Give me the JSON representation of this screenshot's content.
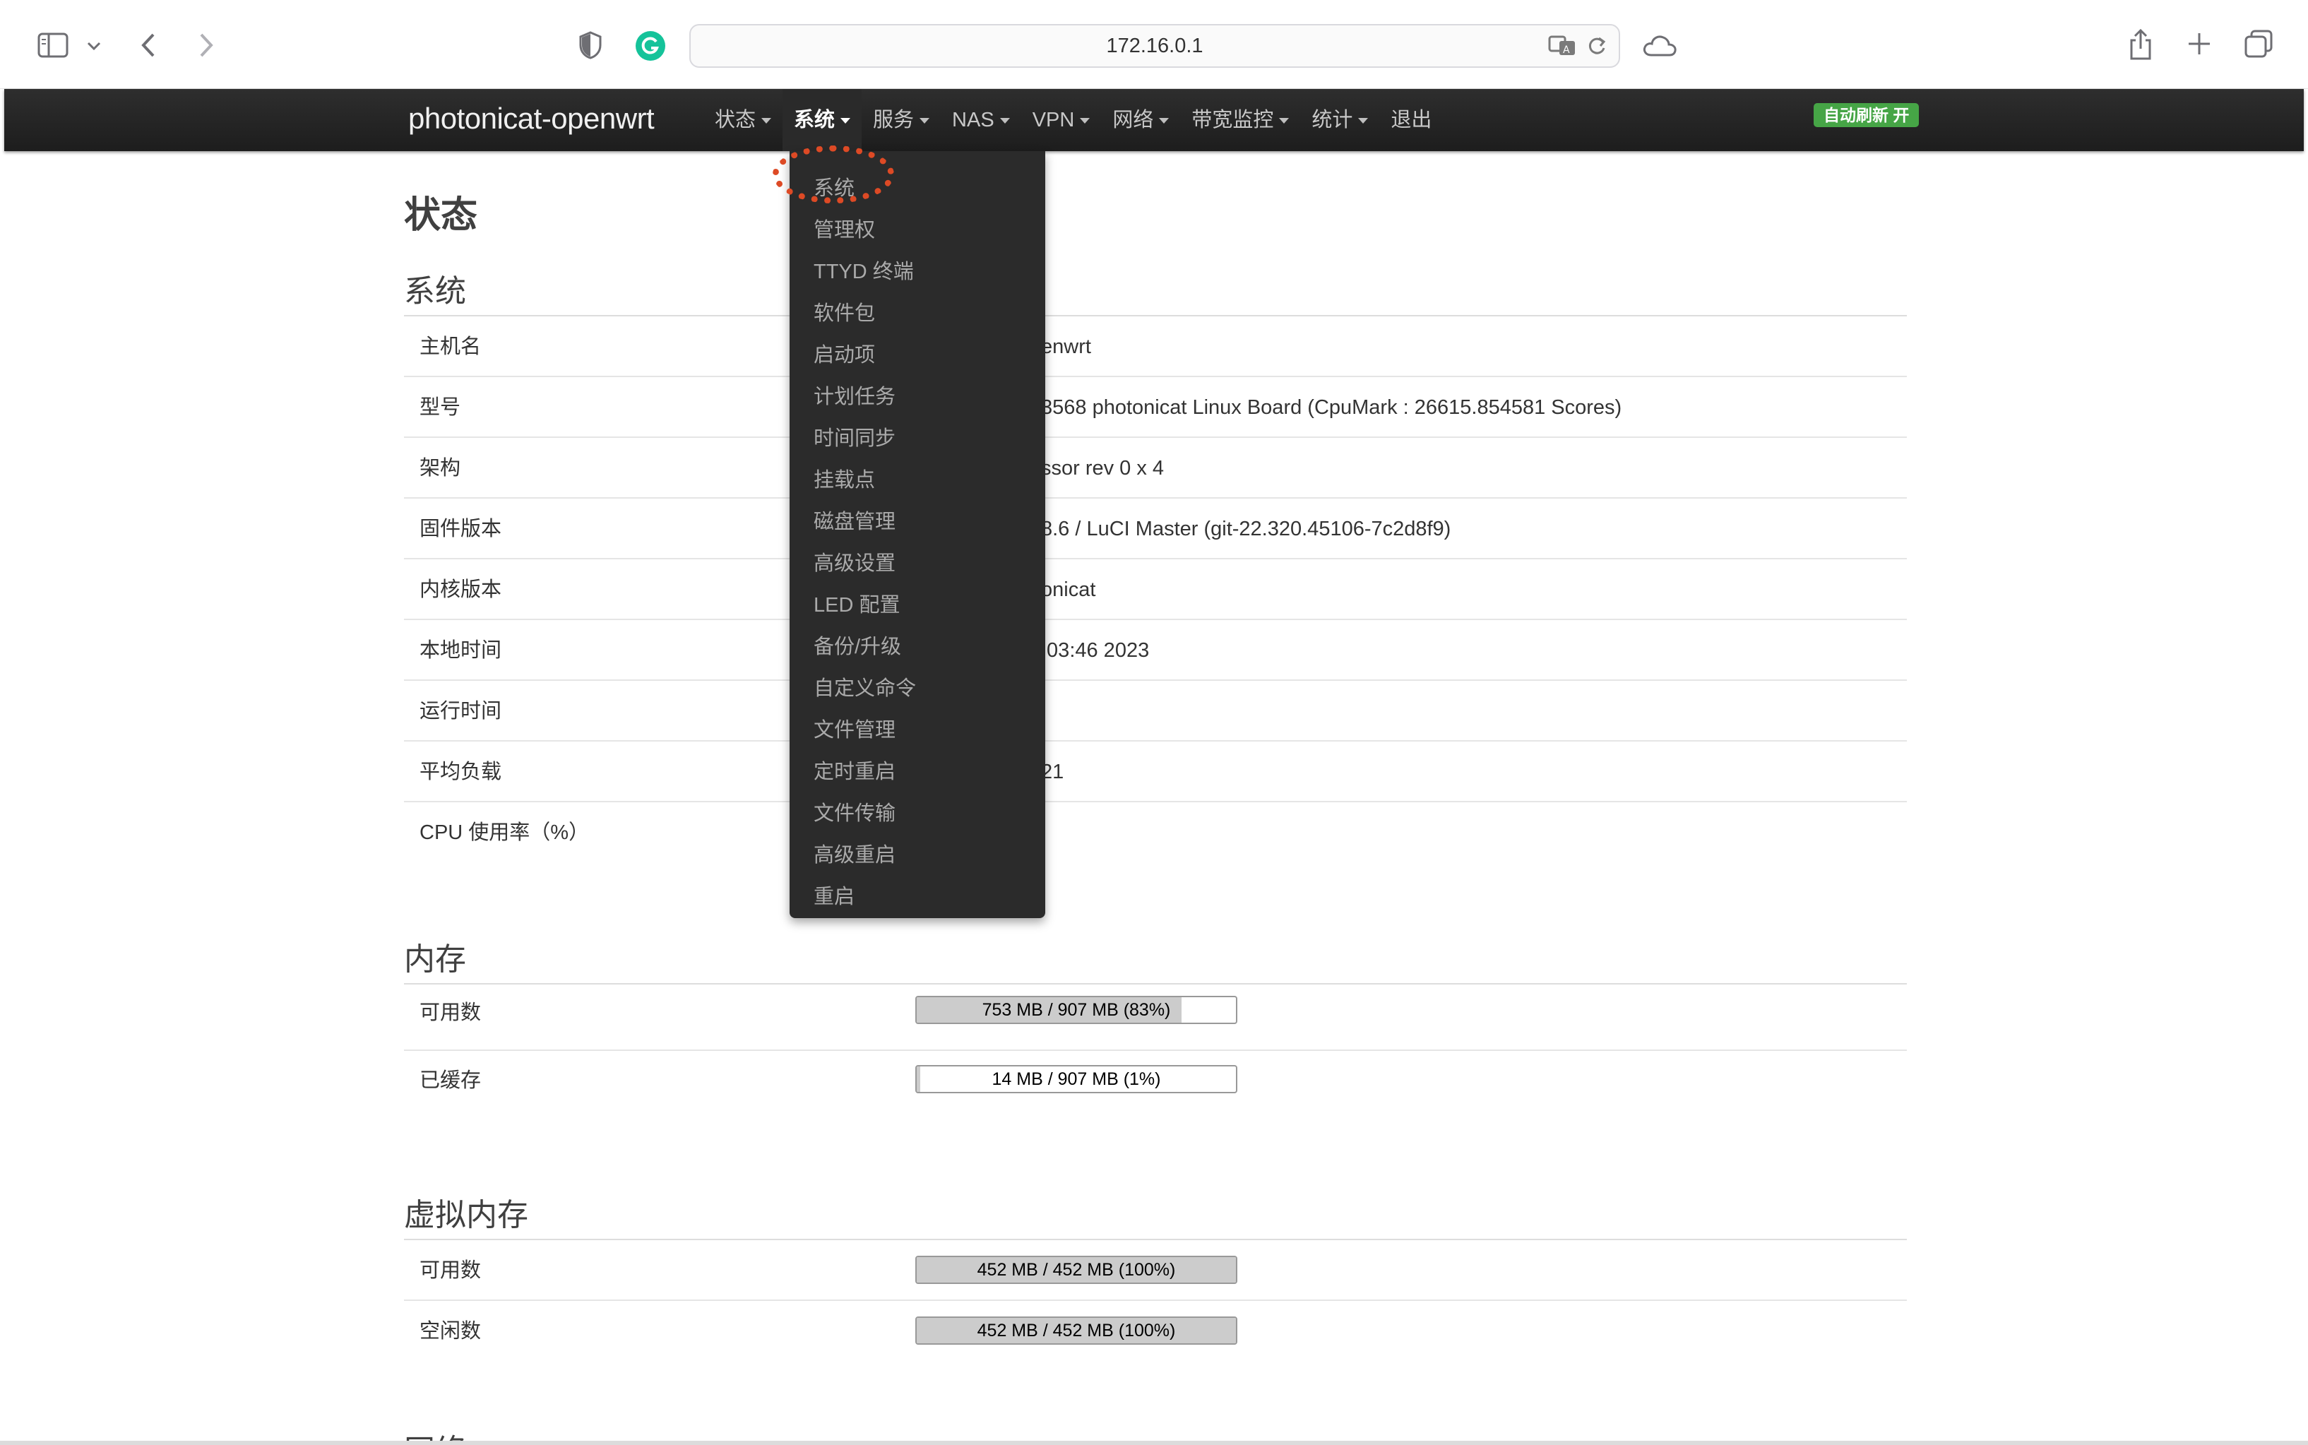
{
  "browser": {
    "url": "172.16.0.1"
  },
  "navbar": {
    "brand": "photonicat-openwrt",
    "items": [
      {
        "label": "状态"
      },
      {
        "label": "系统"
      },
      {
        "label": "服务"
      },
      {
        "label": "NAS"
      },
      {
        "label": "VPN"
      },
      {
        "label": "网络"
      },
      {
        "label": "带宽监控"
      },
      {
        "label": "统计"
      },
      {
        "label": "退出"
      }
    ],
    "active_index": 1,
    "auto_refresh": "自动刷新 开",
    "auto_refresh_color": "#46a546"
  },
  "dropdown": {
    "items": [
      "系统",
      "管理权",
      "TTYD 终端",
      "软件包",
      "启动项",
      "计划任务",
      "时间同步",
      "挂载点",
      "磁盘管理",
      "高级设置",
      "LED 配置",
      "备份/升级",
      "自定义命令",
      "文件管理",
      "定时重启",
      "文件传输",
      "高级重启",
      "重启"
    ],
    "highlight_color": "#dd4a25"
  },
  "page": {
    "title": "状态",
    "system": {
      "heading": "系统",
      "rows": [
        {
          "label": "主机名",
          "value": "enwrt"
        },
        {
          "label": "型号",
          "value": "3568 photonicat Linux Board (CpuMark : 26615.854581 Scores)"
        },
        {
          "label": "架构",
          "value": "ssor rev 0 x 4"
        },
        {
          "label": "固件版本",
          "value": "8.6 / LuCI Master (git-22.320.45106-7c2d8f9)"
        },
        {
          "label": "内核版本",
          "value": "onicat"
        },
        {
          "label": "本地时间",
          "value": ":03:46 2023"
        },
        {
          "label": "运行时间",
          "value": ""
        },
        {
          "label": "平均负载",
          "value": "21"
        },
        {
          "label": "CPU 使用率（%）",
          "value": ""
        }
      ]
    },
    "memory": {
      "heading": "内存",
      "rows": [
        {
          "label": "可用数",
          "bar_text": "753 MB / 907 MB (83%)",
          "fraction": 0.83
        },
        {
          "label": "已缓存",
          "bar_text": "14 MB / 907 MB (1%)",
          "fraction": 0.01
        }
      ]
    },
    "swap": {
      "heading": "虚拟内存",
      "rows": [
        {
          "label": "可用数",
          "bar_text": "452 MB / 452 MB (100%)",
          "fraction": 1.0
        },
        {
          "label": "空闲数",
          "bar_text": "452 MB / 452 MB (100%)",
          "fraction": 1.0
        }
      ]
    },
    "next_heading_partial": "网络"
  }
}
